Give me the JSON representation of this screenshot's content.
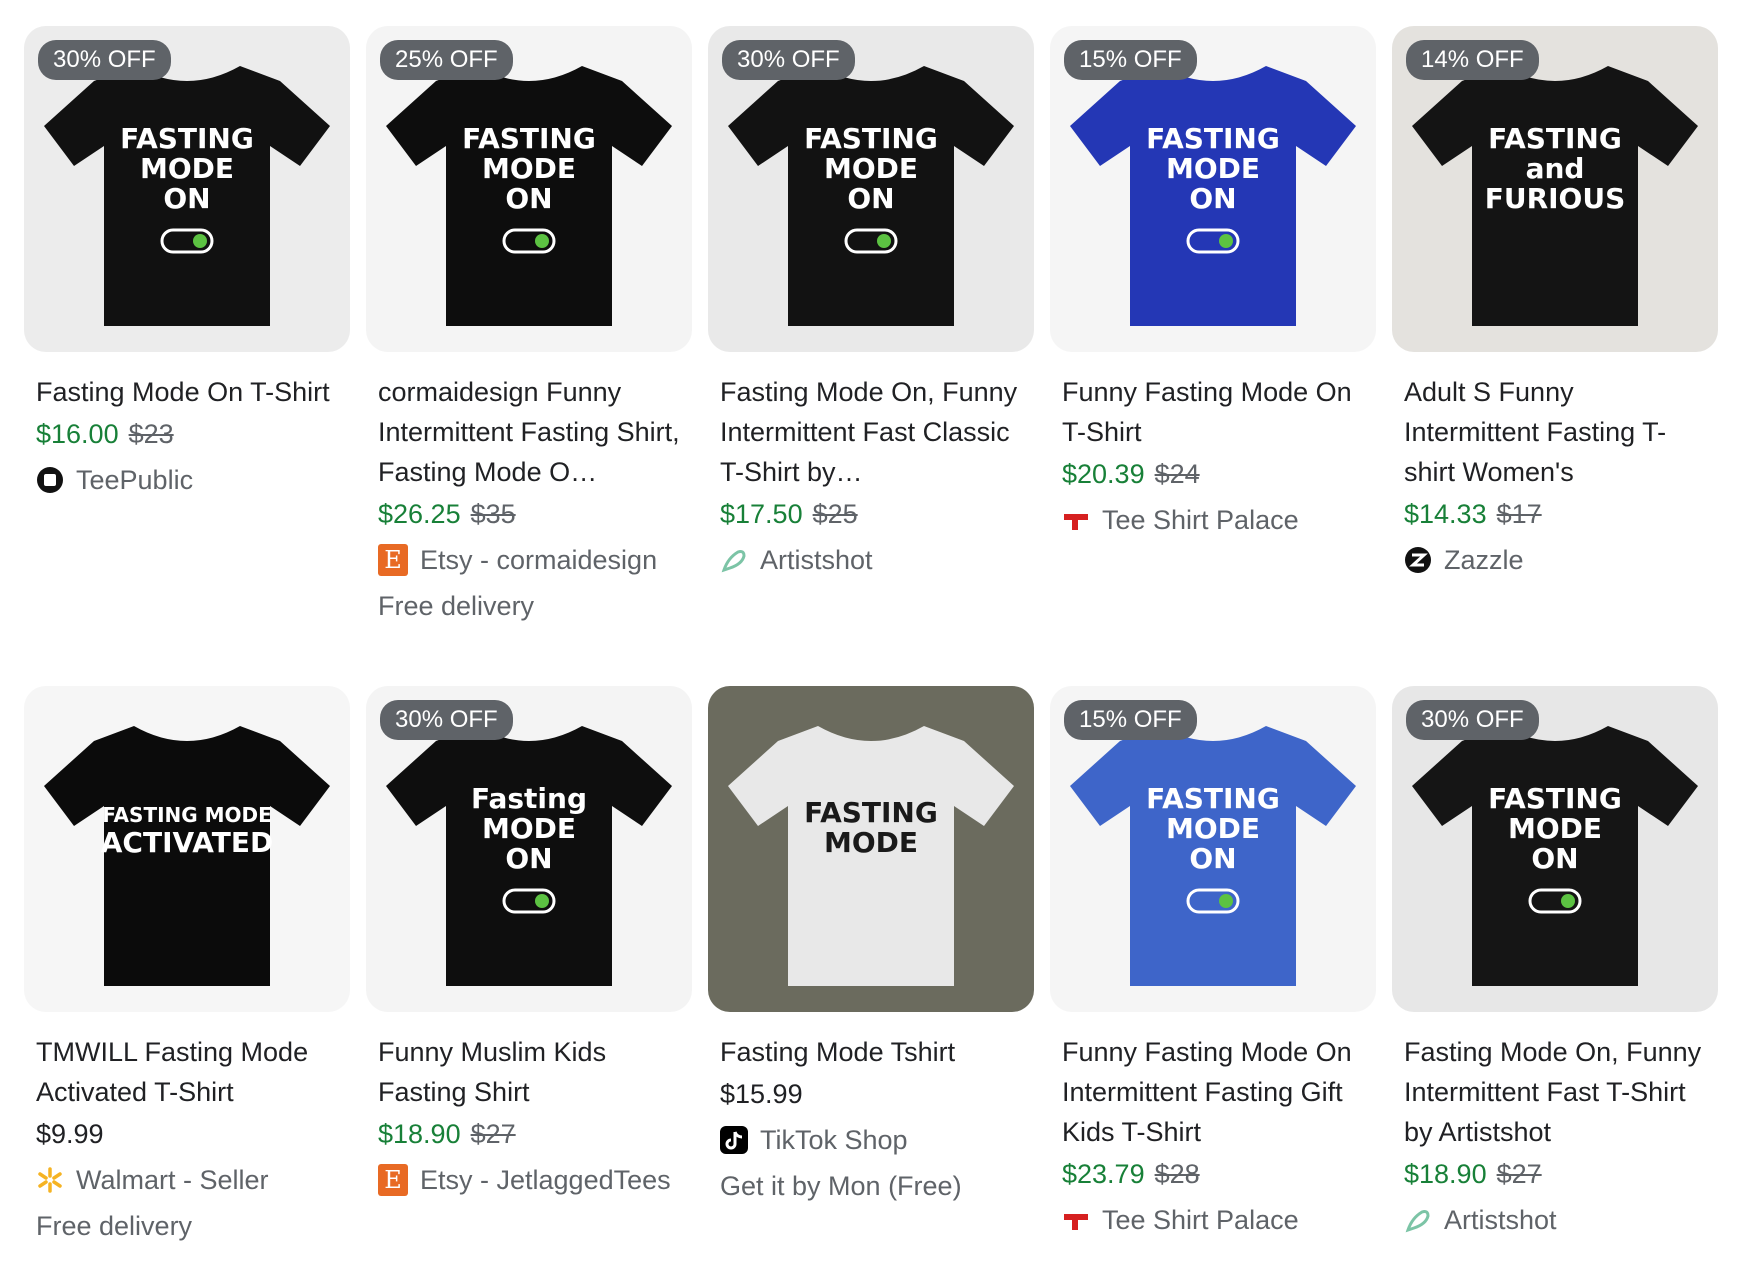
{
  "products": [
    {
      "badge": "30% OFF",
      "title": "Fasting Mode On T-Shirt",
      "price": "$16.00",
      "orig": "$23",
      "store": "TeePublic",
      "note": "",
      "shirt_color": "#111111",
      "bg": "#ececec",
      "icon": "teepublic-icon",
      "art": "FASTING\nMODE\nON"
    },
    {
      "badge": "25% OFF",
      "title": "cormaidesign Funny Intermittent Fasting Shirt, Fasting Mode O…",
      "price": "$26.25",
      "orig": "$35",
      "store": "Etsy - cormaidesign",
      "note": "Free delivery",
      "shirt_color": "#0d0d0d",
      "bg": "#f4f4f4",
      "icon": "etsy-icon",
      "art": "FASTING\nMODE\nON"
    },
    {
      "badge": "30% OFF",
      "title": "Fasting Mode On, Funny Intermittent Fast Classic T-Shirt by…",
      "price": "$17.50",
      "orig": "$25",
      "store": "Artistshot",
      "note": "",
      "shirt_color": "#121212",
      "bg": "#e9e9e9",
      "icon": "artistshot-icon",
      "art": "FASTING\nMODE\nON"
    },
    {
      "badge": "15% OFF",
      "title": "Funny Fasting Mode On T-Shirt",
      "price": "$20.39",
      "orig": "$24",
      "store": "Tee Shirt Palace",
      "note": "",
      "shirt_color": "#2437b5",
      "bg": "#f5f5f5",
      "icon": "teeshirtpalace-icon",
      "art": "FASTING\nMODE\nON"
    },
    {
      "badge": "14% OFF",
      "title": "Adult S Funny Intermittent Fasting T-shirt Women's",
      "price": "$14.33",
      "orig": "$17",
      "store": "Zazzle",
      "note": "",
      "shirt_color": "#141414",
      "bg": "#e4e2de",
      "icon": "zazzle-icon",
      "art": "FASTING\nand\nFURIOUS"
    },
    {
      "badge": "",
      "title": "TMWILL Fasting Mode Activated T-Shirt",
      "price": "$9.99",
      "orig": "",
      "store": "Walmart - Seller",
      "note": "Free delivery",
      "shirt_color": "#0b0b0b",
      "bg": "#f6f6f6",
      "icon": "walmart-icon",
      "art": "FASTING MODE\nACTIVATED"
    },
    {
      "badge": "30% OFF",
      "title": "Funny Muslim Kids Fasting Shirt",
      "price": "$18.90",
      "orig": "$27",
      "store": "Etsy - JetlaggedTees",
      "note": "",
      "shirt_color": "#0e0e0e",
      "bg": "#f4f4f4",
      "icon": "etsy-icon",
      "art": "Fasting\nMODE\nON"
    },
    {
      "badge": "",
      "title": "Fasting Mode Tshirt",
      "price": "$15.99",
      "orig": "",
      "store": "TikTok Shop",
      "note": "Get it by Mon (Free)",
      "shirt_color": "#e8e8e8",
      "bg": "#6b6b5e",
      "icon": "tiktok-icon",
      "art": "FASTING\nMODE"
    },
    {
      "badge": "15% OFF",
      "title": "Funny Fasting Mode On Intermittent Fasting Gift Kids T-Shirt",
      "price": "$23.79",
      "orig": "$28",
      "store": "Tee Shirt Palace",
      "note": "",
      "shirt_color": "#3e65c9",
      "bg": "#f5f5f5",
      "icon": "teeshirtpalace-icon",
      "art": "FASTING\nMODE\nON"
    },
    {
      "badge": "30% OFF",
      "title": "Fasting Mode On, Funny Intermittent Fast T-Shirt by Artistshot",
      "price": "$18.90",
      "orig": "$27",
      "store": "Artistshot",
      "note": "",
      "shirt_color": "#151515",
      "bg": "#e7e7e7",
      "icon": "artistshot-icon",
      "art": "FASTING\nMODE\nON"
    }
  ]
}
